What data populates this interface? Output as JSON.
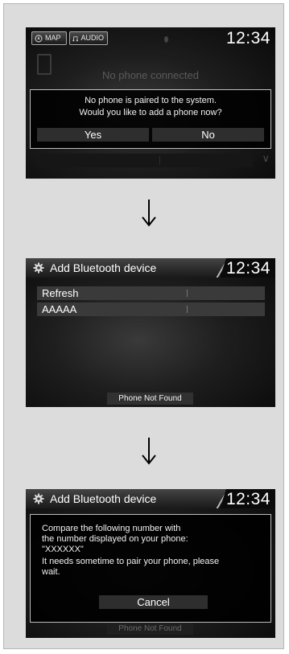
{
  "screen1": {
    "map_label": "MAP",
    "audio_label": "AUDIO",
    "clock": "12:34",
    "background_text": "No phone connected",
    "dialog": {
      "line1": "No phone is paired to the system.",
      "line2": "Would you like to add a phone now?",
      "yes": "Yes",
      "no": "No"
    }
  },
  "screen2": {
    "title": "Add Bluetooth device",
    "clock": "12:34",
    "items": [
      "Refresh",
      "AAAAA"
    ],
    "footer_button": "Phone Not Found"
  },
  "screen3": {
    "title": "Add Bluetooth device",
    "clock": "12:34",
    "dialog": {
      "line1": "Compare the following number with",
      "line2": "the number displayed on your phone:",
      "line3": "\"XXXXXX\"",
      "line4": "It needs sometime to pair your phone, please",
      "line5": "wait.",
      "cancel": "Cancel"
    },
    "footer_button": "Phone Not Found"
  },
  "icons": {
    "map": "compass-icon",
    "audio": "music-note-icon",
    "settings": "gear-icon",
    "flow": "arrow-down-icon"
  }
}
